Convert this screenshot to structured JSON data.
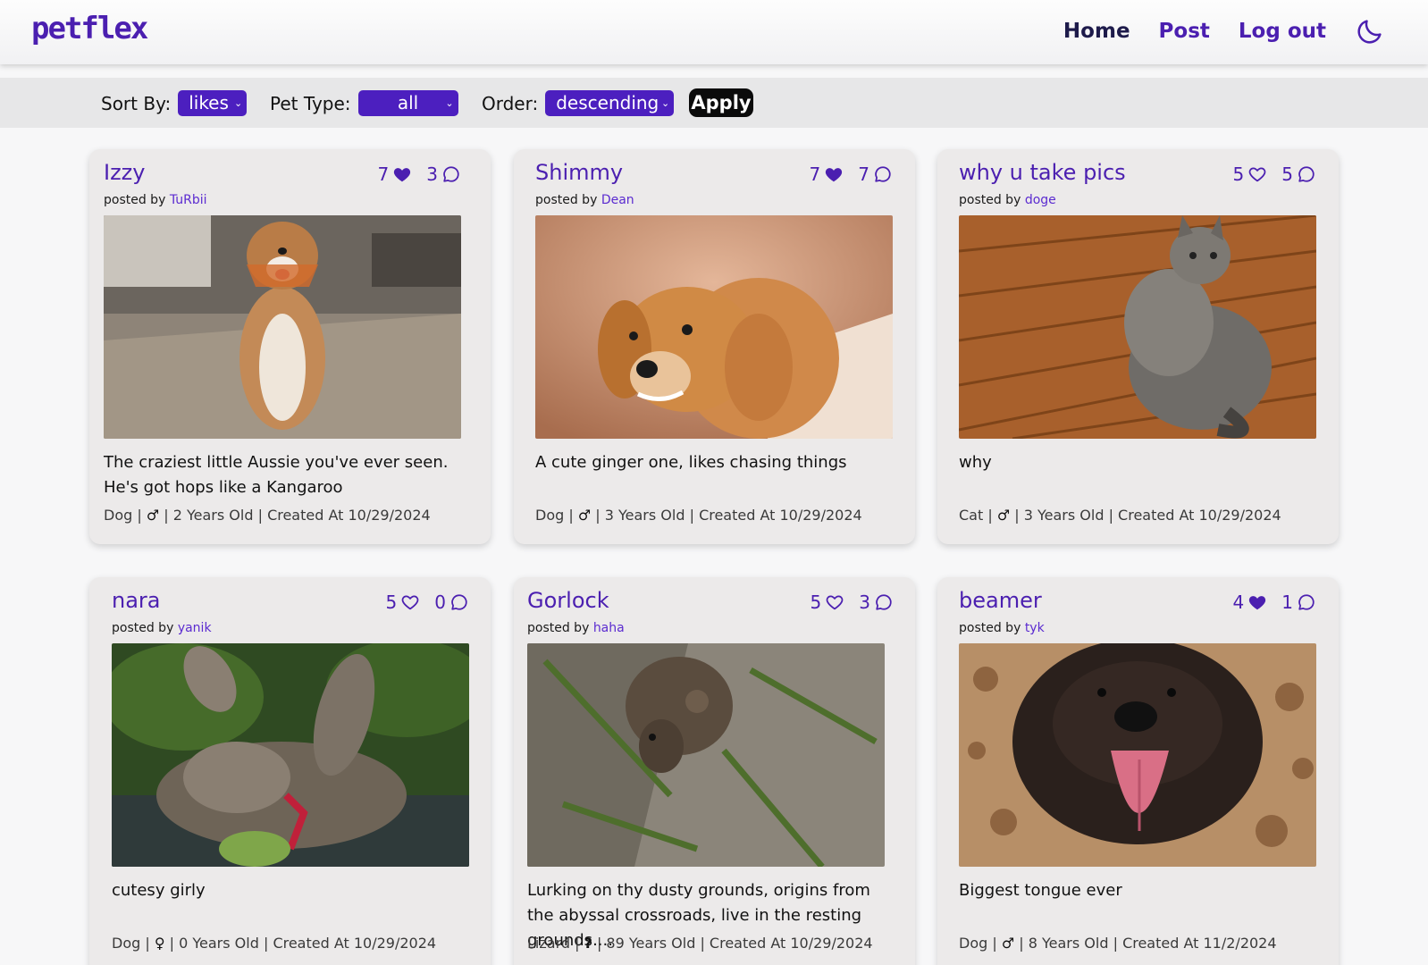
{
  "header": {
    "logo": "petflex",
    "nav": {
      "home": "Home",
      "post": "Post",
      "logout": "Log out"
    },
    "theme_icon": "moon-icon"
  },
  "filters": {
    "sort_label": "Sort By:",
    "sort_value": "likes",
    "pet_type_label": "Pet Type:",
    "pet_type_value": "all",
    "order_label": "Order:",
    "order_value": "descending",
    "apply_label": "Apply"
  },
  "colors": {
    "accent": "#4b1fb0",
    "select_bg": "#4c1fbf",
    "card_bg": "#eceaea"
  },
  "posts": [
    {
      "name": "Izzy",
      "posted_by_prefix": "posted by ",
      "user": "TuRbii",
      "likes": "7",
      "liked": true,
      "comments": "3",
      "caption": "The craziest little Aussie you've ever seen. He's got hops like a Kangaroo",
      "type": "Dog",
      "sex": "♂",
      "age": "2 Years Old",
      "created": "Created At 10/29/2024"
    },
    {
      "name": "Shimmy",
      "posted_by_prefix": "posted by ",
      "user": "Dean",
      "likes": "7",
      "liked": true,
      "comments": "7",
      "caption": "A cute ginger one, likes chasing things",
      "type": "Dog",
      "sex": "♂",
      "age": "3 Years Old",
      "created": "Created At 10/29/2024"
    },
    {
      "name": "why u take pics",
      "posted_by_prefix": "posted by ",
      "user": "doge",
      "likes": "5",
      "liked": false,
      "comments": "5",
      "caption": "why",
      "type": "Cat",
      "sex": "♂",
      "age": "3 Years Old",
      "created": "Created At 10/29/2024"
    },
    {
      "name": "nara",
      "posted_by_prefix": "posted by ",
      "user": "yanik",
      "likes": "5",
      "liked": false,
      "comments": "0",
      "caption": "cutesy girly",
      "type": "Dog",
      "sex": "♀",
      "age": "0 Years Old",
      "created": "Created At 10/29/2024"
    },
    {
      "name": "Gorlock",
      "posted_by_prefix": "posted by ",
      "user": "haha",
      "likes": "5",
      "liked": false,
      "comments": "3",
      "caption": "Lurking on thy dusty grounds, origins from the abyssal crossroads, live in the resting grounds....",
      "type": "Lizard",
      "sex": "?",
      "age": "89 Years Old",
      "created": "Created At 10/29/2024"
    },
    {
      "name": "beamer",
      "posted_by_prefix": "posted by ",
      "user": "tyk",
      "likes": "4",
      "liked": true,
      "comments": "1",
      "caption": "Biggest tongue ever",
      "type": "Dog",
      "sex": "♂",
      "age": "8 Years Old",
      "created": "Created At 11/2/2024"
    }
  ],
  "separator": " | "
}
